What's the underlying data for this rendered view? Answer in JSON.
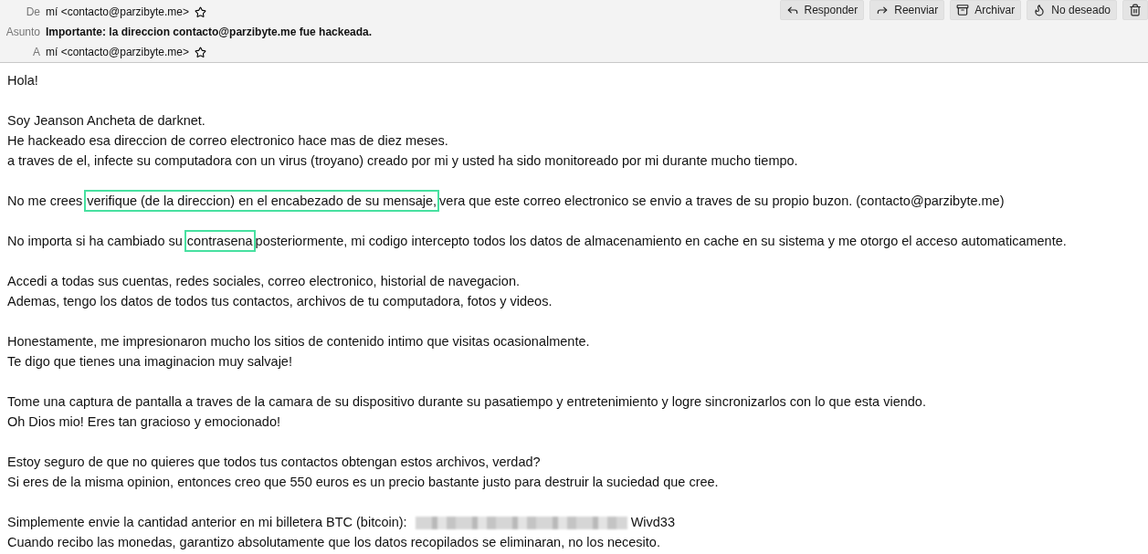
{
  "header": {
    "fields": [
      {
        "label": "De",
        "value": "mí <contacto@parzibyte.me>",
        "kind": "contact"
      },
      {
        "label": "Asunto",
        "value": "Importante: la direccion contacto@parzibyte.me fue hackeada.",
        "kind": "subject"
      },
      {
        "label": "A",
        "value": "mí <contacto@parzibyte.me>",
        "kind": "contact"
      }
    ],
    "buttons": [
      {
        "label": "Responder",
        "kind": "reply"
      },
      {
        "label": "Reenviar",
        "kind": "forward"
      },
      {
        "label": "Archivar",
        "kind": "archive"
      },
      {
        "label": "No deseado",
        "kind": "junk"
      },
      {
        "kind": "delete"
      }
    ]
  },
  "body": {
    "paragraphs": [
      {
        "lines": [
          [
            {
              "kind": "text",
              "text": "Hola!"
            }
          ]
        ]
      },
      {
        "lines": [
          [
            {
              "kind": "text",
              "text": "Soy Jeanson Ancheta de darknet."
            }
          ],
          [
            {
              "kind": "text",
              "text": "He hackeado esa direccion de correo electronico hace mas de diez meses."
            }
          ],
          [
            {
              "kind": "text",
              "text": "a traves de el, infecte su computadora con un virus (troyano) creado por mi y usted ha sido monitoreado por mi durante mucho tiempo."
            }
          ]
        ]
      },
      {
        "lines": [
          [
            {
              "kind": "text",
              "text": "No me crees"
            },
            {
              "kind": "boxed",
              "text": "verifique (de la direccion) en el encabezado de su mensaje,"
            },
            {
              "kind": "text",
              "text": "vera que este correo electronico se envio a traves de su propio buzon. (contacto@parzibyte.me)"
            }
          ]
        ]
      },
      {
        "lines": [
          [
            {
              "kind": "text",
              "text": "No importa si ha cambiado su"
            },
            {
              "kind": "boxed",
              "text": "contrasena"
            },
            {
              "kind": "text",
              "text": "posteriormente, mi codigo intercepto todos los datos de almacenamiento en cache en su sistema y me otorgo el acceso automaticamente."
            }
          ]
        ]
      },
      {
        "lines": [
          [
            {
              "kind": "text",
              "text": "Accedi a todas sus cuentas, redes sociales, correo electronico, historial de navegacion."
            }
          ],
          [
            {
              "kind": "text",
              "text": "Ademas, tengo los datos de todos tus contactos, archivos de tu computadora, fotos y videos."
            }
          ]
        ]
      },
      {
        "lines": [
          [
            {
              "kind": "text",
              "text": "Honestamente, me impresionaron mucho los sitios de contenido intimo que visitas ocasionalmente."
            }
          ],
          [
            {
              "kind": "text",
              "text": "Te digo que tienes una imaginacion muy salvaje!"
            }
          ]
        ]
      },
      {
        "lines": [
          [
            {
              "kind": "text",
              "text": "Tome una captura de pantalla a traves de la camara de su dispositivo durante su pasatiempo y entretenimiento y logre sincronizarlos con lo que esta viendo."
            }
          ],
          [
            {
              "kind": "text",
              "text": "Oh Dios mio! Eres tan gracioso y emocionado!"
            }
          ]
        ]
      },
      {
        "lines": [
          [
            {
              "kind": "text",
              "text": "Estoy seguro de que no quieres que todos tus contactos obtengan estos archivos, verdad?"
            }
          ],
          [
            {
              "kind": "text",
              "text": "Si eres de la misma opinion, entonces creo que 550 euros es un precio bastante justo para destruir la suciedad que cree."
            }
          ]
        ]
      },
      {
        "lines": [
          [
            {
              "kind": "text",
              "text": "Simplemente envie la cantidad anterior en mi billetera BTC (bitcoin):"
            },
            {
              "kind": "redacted"
            },
            {
              "kind": "text",
              "text": "Wivd33"
            }
          ],
          [
            {
              "kind": "text",
              "text": "Cuando recibo las monedas, garantizo absolutamente que los datos recopilados se eliminaran, no los necesito."
            }
          ]
        ]
      }
    ]
  }
}
